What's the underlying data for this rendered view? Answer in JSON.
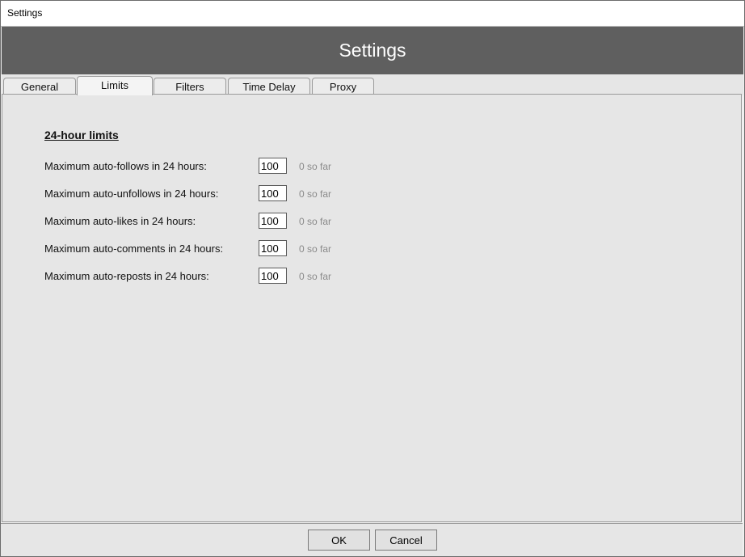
{
  "window": {
    "title": "Settings"
  },
  "header": {
    "title": "Settings"
  },
  "tabs": [
    {
      "label": "General",
      "active": false
    },
    {
      "label": "Limits",
      "active": true
    },
    {
      "label": "Filters",
      "active": false
    },
    {
      "label": "Time Delay",
      "active": false
    },
    {
      "label": "Proxy",
      "active": false
    }
  ],
  "limits": {
    "section_title": "24-hour limits",
    "rows": [
      {
        "label": "Maximum auto-follows in 24 hours:",
        "value": "100",
        "status": "0 so far"
      },
      {
        "label": "Maximum auto-unfollows in 24 hours:",
        "value": "100",
        "status": "0 so far"
      },
      {
        "label": "Maximum auto-likes in 24 hours:",
        "value": "100",
        "status": "0 so far"
      },
      {
        "label": "Maximum auto-comments in 24 hours:",
        "value": "100",
        "status": "0 so far"
      },
      {
        "label": "Maximum auto-reposts in 24 hours:",
        "value": "100",
        "status": "0 so far"
      }
    ]
  },
  "footer": {
    "ok_label": "OK",
    "cancel_label": "Cancel"
  },
  "colors": {
    "header_bg": "#5f5f5f",
    "panel_bg": "#e6e6e6",
    "status_text": "#8a8a8a"
  }
}
